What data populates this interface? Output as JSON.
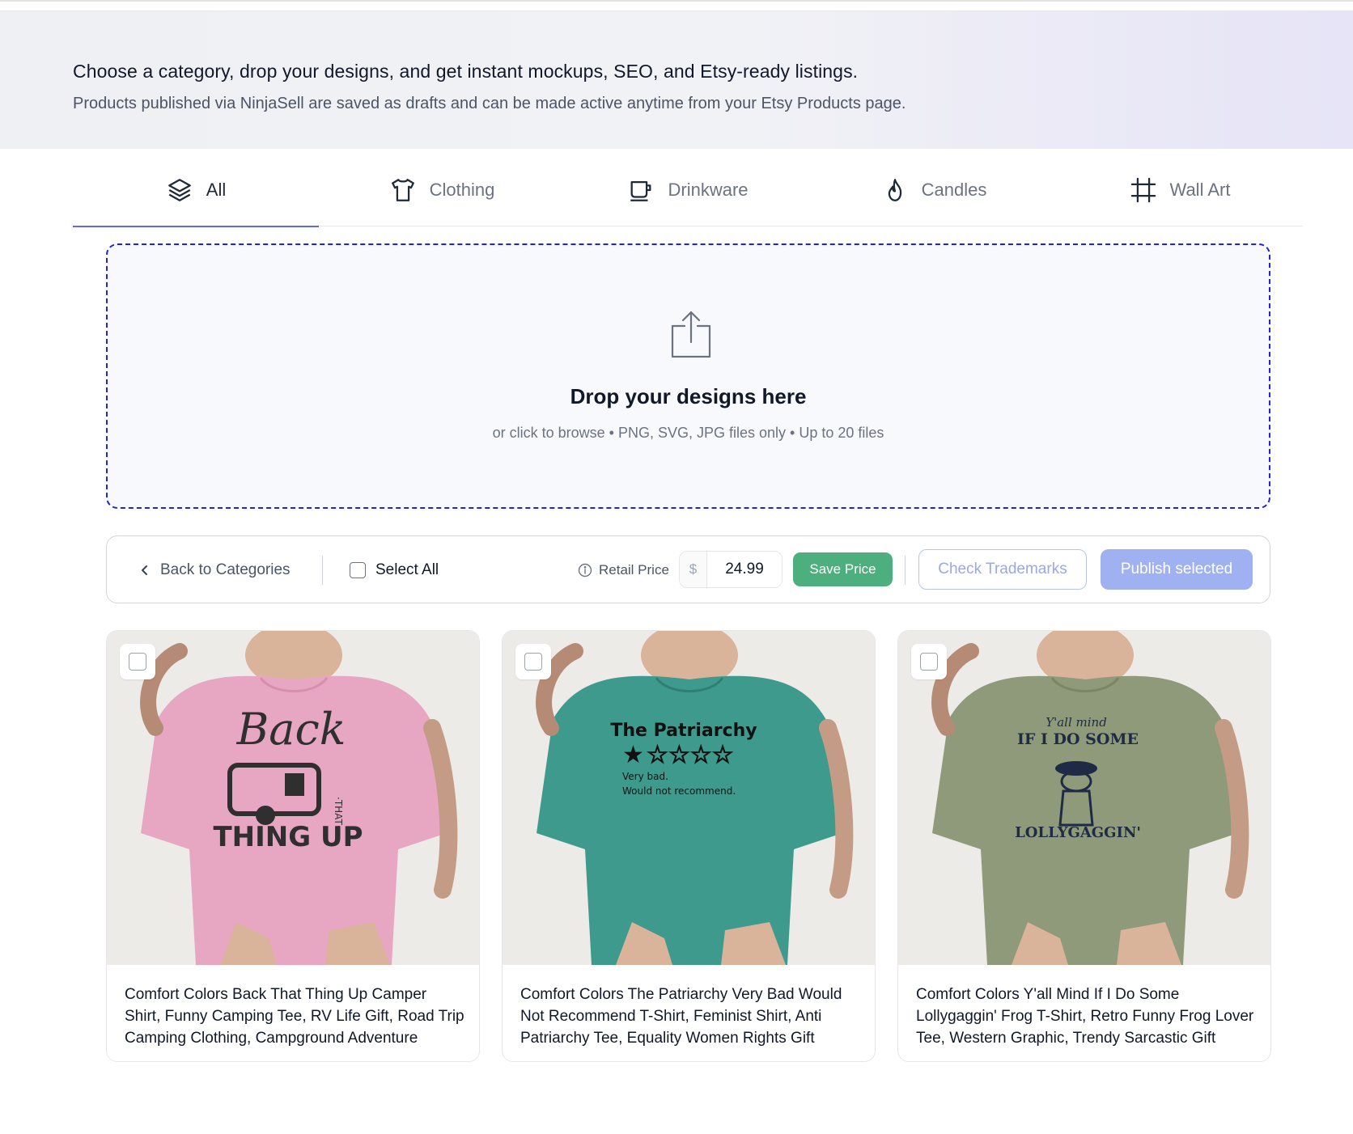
{
  "hero": {
    "title": "Choose a category, drop your designs, and get instant mockups, SEO, and Etsy-ready listings.",
    "subtitle": "Products published via NinjaSell are saved as drafts and can be made active anytime from your Etsy Products page."
  },
  "tabs": [
    {
      "label": "All",
      "icon": "layers-icon",
      "active": true
    },
    {
      "label": "Clothing",
      "icon": "shirt-icon",
      "active": false
    },
    {
      "label": "Drinkware",
      "icon": "mug-icon",
      "active": false
    },
    {
      "label": "Candles",
      "icon": "flame-icon",
      "active": false
    },
    {
      "label": "Wall Art",
      "icon": "frame-icon",
      "active": false
    }
  ],
  "dropzone": {
    "icon": "upload-icon",
    "title": "Drop your designs here",
    "subtitle": "or click to browse • PNG, SVG, JPG files only • Up to 20 files"
  },
  "toolbar": {
    "back_label": "Back to Categories",
    "select_all_label": "Select All",
    "retail_label": "Retail Price",
    "currency": "$",
    "price_value": "24.99",
    "save_label": "Save Price",
    "check_label": "Check Trademarks",
    "publish_label": "Publish selected"
  },
  "products": [
    {
      "title": "Comfort Colors Back That Thing Up Camper Shirt, Funny Camping Tee, RV Life Gift, Road Trip Camping Clothing, Campground Adventure",
      "shirt_color": "#e7a7c2",
      "design": [
        "Back",
        "THAT",
        "THING UP"
      ]
    },
    {
      "title": "Comfort Colors The Patriarchy Very Bad Would Not Recommend T-Shirt, Feminist Shirt, Anti Patriarchy Tee, Equality Women Rights Gift",
      "shirt_color": "#3e9a8c",
      "design": [
        "The Patriarchy",
        "Very bad.",
        "Would not recommend."
      ]
    },
    {
      "title": "Comfort Colors Y'all Mind If I Do Some Lollygaggin' Frog T-Shirt, Retro Funny Frog Lover Tee, Western Graphic, Trendy Sarcastic Gift",
      "shirt_color": "#8f9a7a",
      "design": [
        "Y'all mind",
        "IF I DO SOME",
        "LOLLYGAGGIN'"
      ]
    }
  ],
  "colors": {
    "accent": "#6366f1",
    "dropzone_border": "#2222dd",
    "save_green": "#4caf7d",
    "publish_blue": "#9fb1f1"
  }
}
